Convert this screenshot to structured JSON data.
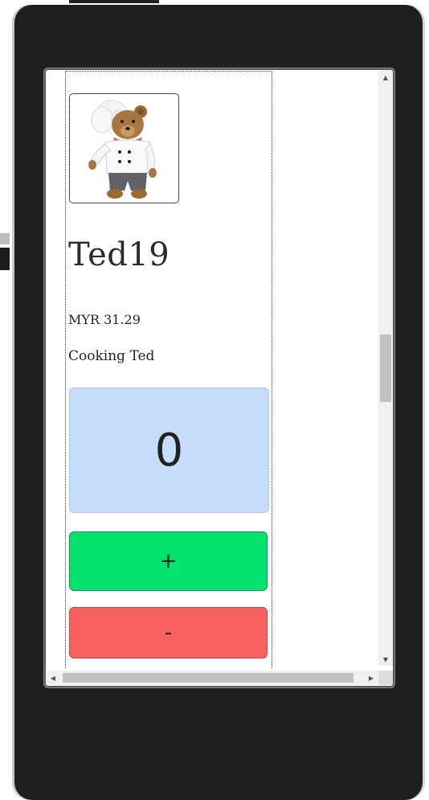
{
  "product": {
    "name": "Ted19",
    "price": "MYR 31.29",
    "description": "Cooking Ted",
    "image_icon": "teddy-bear-chef"
  },
  "quantity": {
    "value": "0"
  },
  "buttons": {
    "increment_label": "+",
    "decrement_label": "-"
  },
  "colors": {
    "quantity_bg": "#c5ddfa",
    "increment_bg": "#05e36d",
    "decrement_bg": "#f86161",
    "device_frame": "#1f1f1f"
  },
  "icons": {
    "scroll_up": "▲",
    "scroll_down": "▼",
    "scroll_left": "◀",
    "scroll_right": "▶"
  }
}
